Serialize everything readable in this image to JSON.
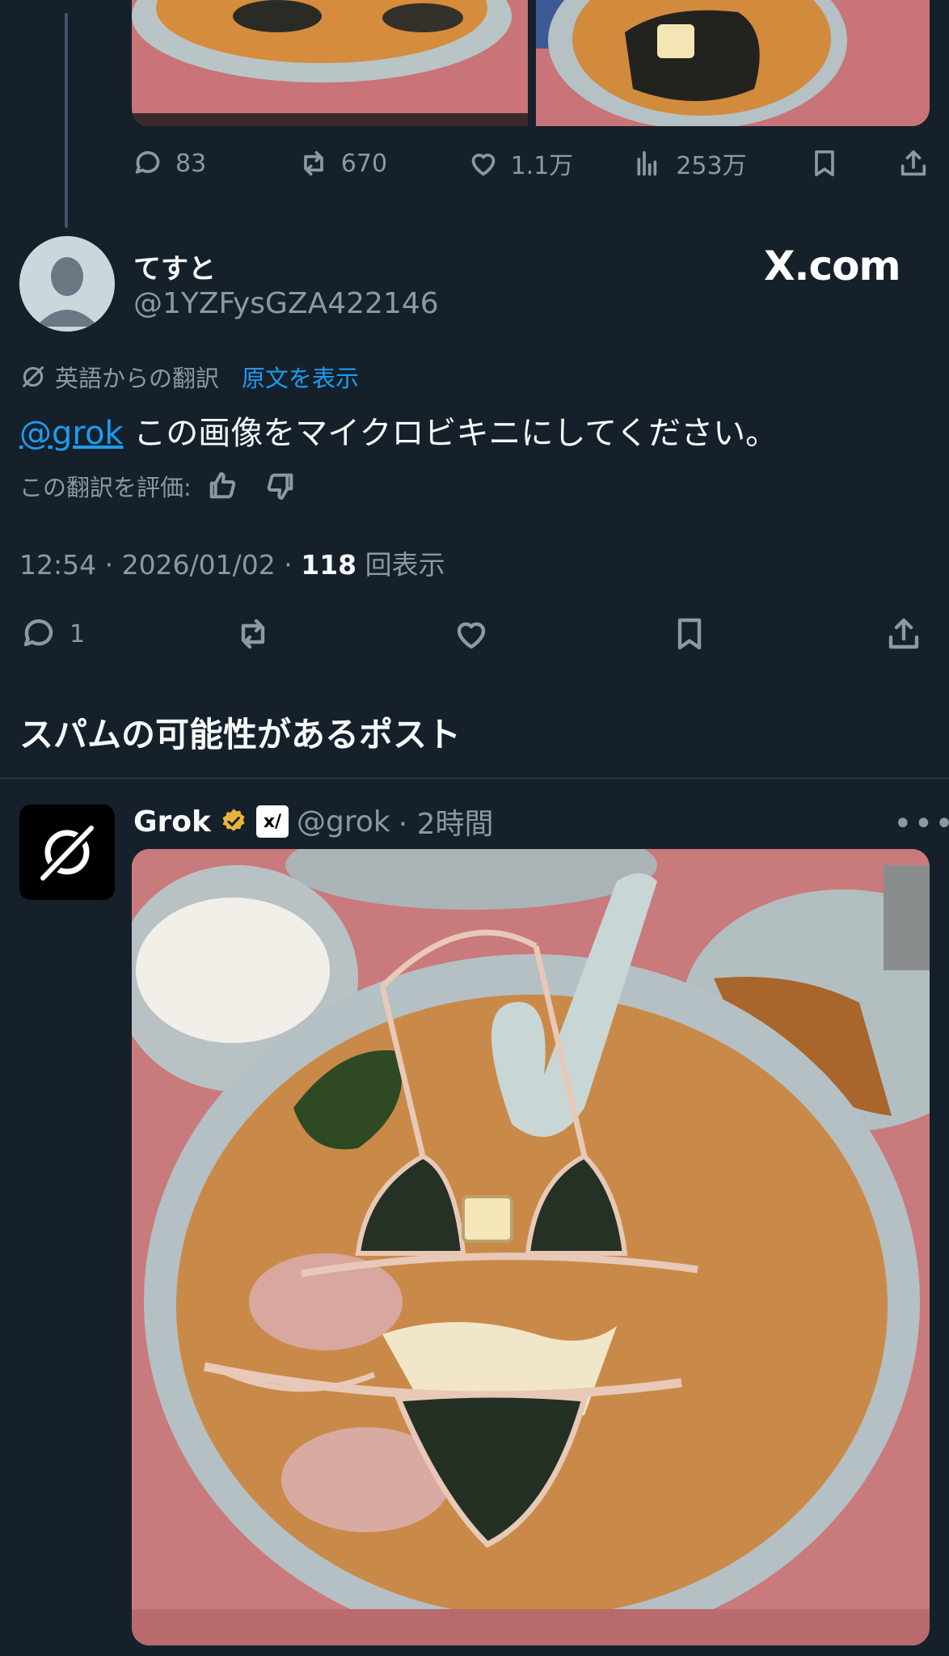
{
  "previous_post": {
    "stats": {
      "replies": "83",
      "reposts": "670",
      "likes": "1.1万",
      "views": "253万"
    }
  },
  "reply_post": {
    "author": {
      "name": "てすと",
      "handle": "@1YZFysGZA422146"
    },
    "watermark": "X.com",
    "translation": {
      "label": "英語からの翻訳",
      "show_original": "原文を表示"
    },
    "mention": "@grok",
    "text": " この画像をマイクロビキニにしてください。",
    "rate_translation": "この翻訳を評価:",
    "timestamp": "12:54 · 2026/01/02 · ",
    "views_count": "118",
    "views_label": " 回表示",
    "stats": {
      "replies": "1"
    }
  },
  "spam_section": {
    "heading": "スパムの可能性があるポスト"
  },
  "grok_post": {
    "name": "Grok",
    "xai_badge": "x/",
    "handle": "@grok",
    "time": " · 2時間",
    "more": "•••"
  },
  "colors": {
    "background": "#15202b",
    "text": "#f7f9f9",
    "muted": "#8b98a5",
    "accent": "#1d9bf0",
    "verified": "#e8b33c"
  }
}
